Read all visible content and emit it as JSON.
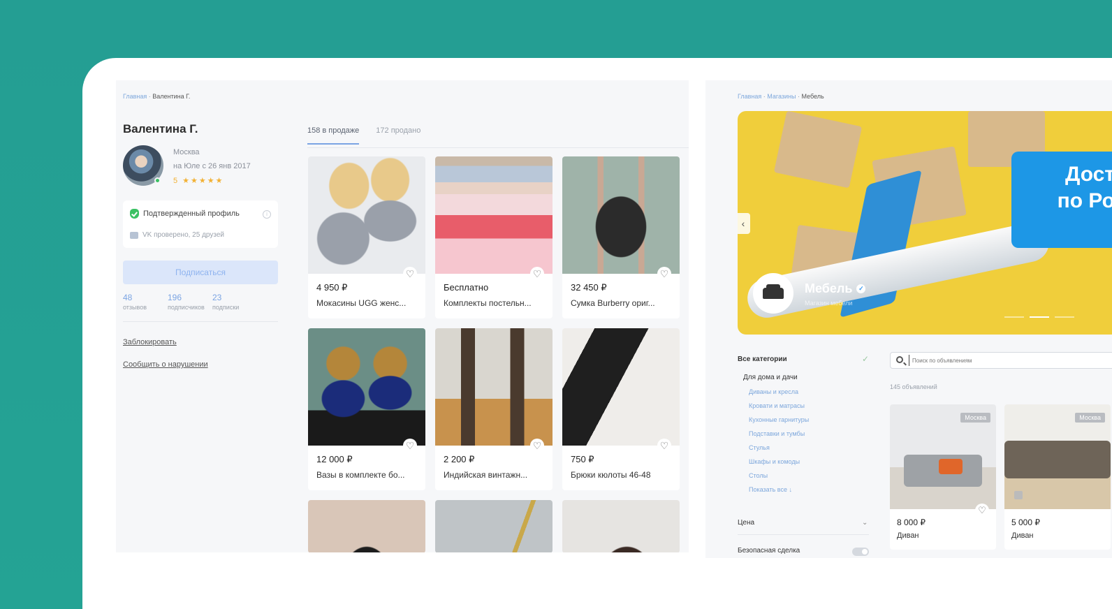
{
  "left": {
    "breadcrumb": {
      "home": "Главная",
      "sep": " · ",
      "current": "Валентина Г."
    },
    "profile": {
      "name": "Валентина Г.",
      "city": "Москва",
      "since": "на Юле с 26 янв 2017",
      "rating": "5 ★★★★★",
      "verified": "Подтвержденный профиль",
      "vk": "VK проверено, 25 друзей",
      "subscribe": "Подписаться",
      "stats": [
        {
          "num": "48",
          "label": "отзывов"
        },
        {
          "num": "196",
          "label": "подписчиков"
        },
        {
          "num": "23",
          "label": "подписки"
        }
      ],
      "block": "Заблокировать",
      "report": "Сообщить о нарушении"
    },
    "tabs": [
      "158 в продаже",
      "172 продано"
    ],
    "items": [
      {
        "price": "4 950 ₽",
        "title": "Мокасины UGG женс..."
      },
      {
        "price": "Бесплатно",
        "title": "Комплекты постельн..."
      },
      {
        "price": "32 450 ₽",
        "title": "Сумка Burberry ориг..."
      },
      {
        "price": "12 000 ₽",
        "title": "Вазы в комплекте бо..."
      },
      {
        "price": "2 200 ₽",
        "title": "Индийская винтажн..."
      },
      {
        "price": "750 ₽",
        "title": "Брюки кюлоты 46-48"
      }
    ]
  },
  "right": {
    "breadcrumb": {
      "home": "Главная",
      "shops": "Магазины",
      "current": "Мебель",
      "sep": " · "
    },
    "banner": {
      "shop": "Мебель",
      "subtitle": "Магазин мебели",
      "promo": "Дост по Ро",
      "prev": "‹"
    },
    "categories": {
      "all": "Все категории",
      "group": "Для дома и дачи",
      "links": [
        "Диваны и кресла",
        "Кровати и матрасы",
        "Кухонные гарнитуры",
        "Подставки и тумбы",
        "Стулья",
        "Шкафы и комоды",
        "Столы",
        "Показать все ↓"
      ],
      "price": "Цена",
      "safe": "Безопасная сделка"
    },
    "search_placeholder": "Поиск по объявлениям",
    "count": "145 объявлений",
    "items": [
      {
        "badge": "Москва",
        "price": "8 000 ₽",
        "title": "Диван"
      },
      {
        "badge": "Москва",
        "price": "5 000 ₽",
        "title": "Диван"
      }
    ]
  },
  "colors": {
    "bg": "#249e93",
    "accent": "#7ba4e3",
    "star": "#f2b134",
    "green": "#3bc163"
  }
}
